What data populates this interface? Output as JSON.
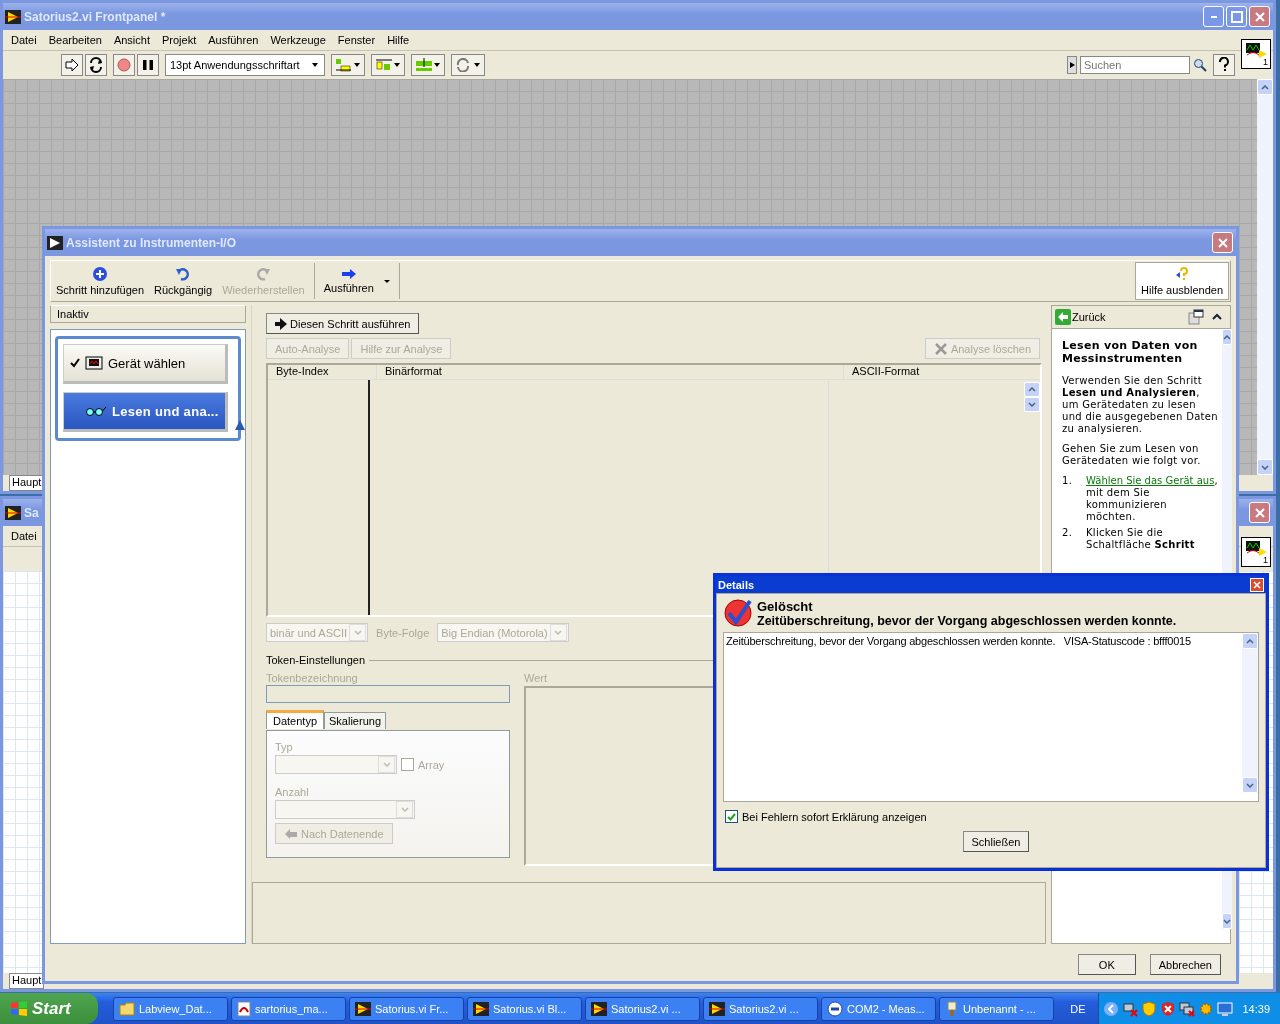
{
  "frontpanel_window": {
    "title": "Satorius2.vi Frontpanel *",
    "menu": [
      "Datei",
      "Bearbeiten",
      "Ansicht",
      "Projekt",
      "Ausführen",
      "Werkzeuge",
      "Fenster",
      "Hilfe"
    ],
    "font_selector": "13pt Anwendungsschriftart",
    "search": {
      "placeholder": "Suchen"
    },
    "connector_number": "1",
    "status_label": "Haupt"
  },
  "second_window": {
    "title": "Sa",
    "menu": [
      "Datei"
    ],
    "connector_number": "1",
    "status_label": "Haupt"
  },
  "assistant": {
    "title": "Assistent zu Instrumenten-I/O",
    "toolbar": [
      {
        "label": "Schritt hinzufügen",
        "kind": "add",
        "disabled": false
      },
      {
        "label": "Rückgängig",
        "kind": "undo",
        "disabled": false
      },
      {
        "label": "Wiederherstellen",
        "kind": "redo",
        "disabled": true
      },
      {
        "label": "Ausführen",
        "kind": "run",
        "disabled": false
      }
    ],
    "hide_help": "Hilfe ausblenden",
    "step_header": "Inaktiv",
    "steps": [
      {
        "label": "Gerät wählen",
        "kind": "device",
        "selected": false,
        "checked": true
      },
      {
        "label": "Lesen und ana...",
        "kind": "read",
        "selected": true,
        "checked": false
      }
    ],
    "run_step": "Diesen Schritt ausführen",
    "auto_analysis": "Auto-Analyse",
    "analysis_help": "Hilfe zur Analyse",
    "delete_analysis": "Analyse löschen",
    "table": {
      "columns": [
        "Byte-Index",
        "Binärformat",
        "ASCII-Format"
      ]
    },
    "display_mode": "binär und ASCII",
    "byte_order_label": "Byte-Folge",
    "byte_order": "Big Endian (Motorola)",
    "token_group": "Token-Einstellungen",
    "token_name_label": "Tokenbezeichnung",
    "value_label": "Wert",
    "tabs": [
      {
        "label": "Datentyp",
        "selected": true
      },
      {
        "label": "Skalierung",
        "selected": false
      }
    ],
    "type_label": "Typ",
    "array": {
      "label": "Array",
      "checked": false
    },
    "count_label": "Anzahl",
    "to_end": "Nach Datenende",
    "help": {
      "back": "Zurück",
      "heading": "Lesen von Daten von Messinstrumenten",
      "paragraphs": [
        "Verwenden Sie den Schritt **Lesen und Analysieren**, um Gerätedaten zu lesen und die ausgegebenen Daten zu analysieren.",
        "Gehen Sie zum Lesen von Gerätedaten wie folgt vor."
      ],
      "steps": [
        {
          "number": "1.",
          "link": "Wählen Sie das Gerät aus",
          "text": ", mit dem Sie kommunizieren möchten."
        },
        {
          "number": "2.",
          "text": "Klicken Sie die Schaltfläche **Schritt**"
        }
      ]
    },
    "ok": "OK",
    "cancel": "Abbrechen"
  },
  "details_dialog": {
    "title": "Details",
    "heading": "Gelöscht",
    "message": "Zeitüberschreitung, bevor der Vorgang abgeschlossen werden konnte.",
    "detail_text": "Zeitüberschreitung, bevor der Vorgang abgeschlossen werden konnte.   VISA-Statuscode : bfff0015",
    "show_explanation": {
      "label": "Bei Fehlern sofort Erklärung anzeigen",
      "checked": true
    },
    "close": "Schließen"
  },
  "taskbar": {
    "start": "Start",
    "items": [
      {
        "label": "Labview_Dat...",
        "kind": "folder"
      },
      {
        "label": "sartorius_ma...",
        "kind": "pdf"
      },
      {
        "label": "Satorius.vi Fr...",
        "kind": "vi"
      },
      {
        "label": "Satorius.vi Bl...",
        "kind": "vi"
      },
      {
        "label": "Satorius2.vi ...",
        "kind": "vi"
      },
      {
        "label": "Satorius2.vi ...",
        "kind": "vi"
      },
      {
        "label": "COM2 - Meas...",
        "kind": "serial"
      },
      {
        "label": "Unbenannt - ...",
        "kind": "paint"
      }
    ],
    "language": "DE",
    "clock": "14:39"
  }
}
